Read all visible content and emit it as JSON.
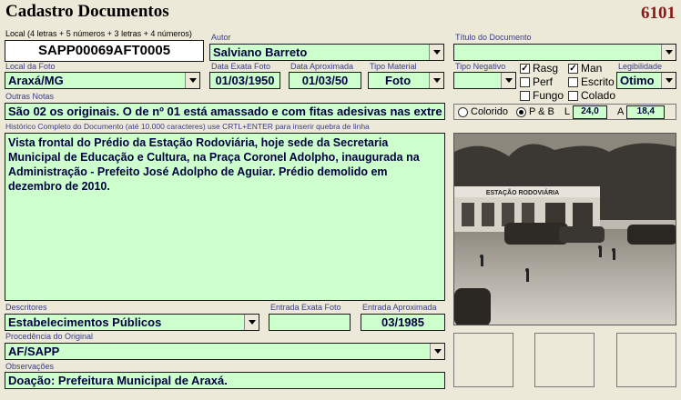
{
  "header": {
    "title": "Cadastro Documentos",
    "record_number": "6101"
  },
  "local": {
    "label": "Local (4 letras + 5 números + 3 letras + 4 números)",
    "value": "SAPP00069AFT0005"
  },
  "autor": {
    "label": "Autor",
    "value": "Salviano Barreto"
  },
  "titulo": {
    "label": "Título do Documento",
    "value": ""
  },
  "local_foto": {
    "label": "Local da Foto",
    "value": "Araxá/MG"
  },
  "data_exata": {
    "label": "Data Exata Foto",
    "value": "01/03/1950"
  },
  "data_aprox": {
    "label": "Data Aproximada",
    "value": "01/03/50"
  },
  "tipo_material": {
    "label": "Tipo Material",
    "value": "Foto"
  },
  "tipo_negativo": {
    "label": "Tipo Negativo",
    "value": ""
  },
  "checks": [
    {
      "label": "Rasg",
      "checked": true
    },
    {
      "label": "Man",
      "checked": true
    },
    {
      "label": "Perf",
      "checked": false
    },
    {
      "label": "Escrito",
      "checked": false
    },
    {
      "label": "Fungo",
      "checked": false
    },
    {
      "label": "Colado",
      "checked": false
    }
  ],
  "legibilidade": {
    "label": "Legibilidade",
    "value": "Otimo"
  },
  "outras_notas": {
    "label": "Outras Notas",
    "value": "São 02 os originais. O de nº 01 está amassado e com fitas adesivas nas extre"
  },
  "color_mode": {
    "colorido": "Colorido",
    "pb": "P & B",
    "selected": "pb"
  },
  "dimensions": {
    "l_label": "L",
    "l_value": "24,0",
    "a_label": "A",
    "a_value": "18,4"
  },
  "historico": {
    "label": "Histórico Completo do Documento (até 10.000 caracteres) use CRTL+ENTER para inserir quebra de linha",
    "value": "Vista frontal do Prédio da Estação Rodoviária, hoje sede da Secretaria Municipal de Educação e Cultura, na Praça Coronel Adolpho, inaugurada na Administração - Prefeito José Adolpho de Aguiar. Prédio demolido em dezembro de 2010."
  },
  "photo": {
    "sign_text": "ESTAÇÃO RODOVIÁRIA"
  },
  "descritores": {
    "label": "Descritores",
    "value": "Estabelecimentos Públicos"
  },
  "entrada_exata": {
    "label": "Entrada Exata Foto",
    "value": ""
  },
  "entrada_aprox": {
    "label": "Entrada Aproximada",
    "value": "03/1985"
  },
  "procedencia": {
    "label": "Procedência do Original",
    "value": "AF/SAPP"
  },
  "observacoes": {
    "label": "Observações",
    "value": "Doação: Prefeitura Municipal de Araxá."
  }
}
